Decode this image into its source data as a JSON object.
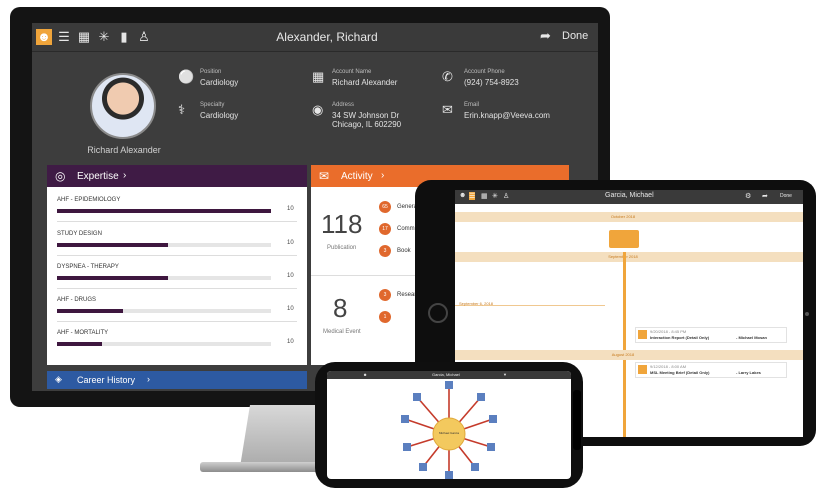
{
  "monitor": {
    "topbar": {
      "title": "Alexander, Richard",
      "done_label": "Done",
      "icons": [
        "person-icon",
        "hierarchy-icon",
        "org-chart-icon",
        "network-icon",
        "bar-chart-icon",
        "people-icon",
        "share-icon"
      ]
    },
    "profile": {
      "name": "Richard Alexander",
      "fields": [
        {
          "label": "Position",
          "value": "Cardiology"
        },
        {
          "label": "Specialty",
          "value": "Cardiology"
        },
        {
          "label": "Account Name",
          "value": "Richard Alexander"
        },
        {
          "label": "Address",
          "value": "34 SW Johnson Dr\nChicago, IL 602290"
        },
        {
          "label": "Account Phone",
          "value": "(924) 754-8923"
        },
        {
          "label": "Email",
          "value": "Erin.knapp@Veeva.com"
        }
      ]
    },
    "expertise": {
      "header": "Expertise",
      "items": [
        {
          "label": "AHF - EPIDEMIOLOGY",
          "value": 10,
          "fill": 1.0
        },
        {
          "label": "STUDY DESIGN",
          "value": 10,
          "fill": 0.52
        },
        {
          "label": "DYSPNEA - THERAPY",
          "value": 10,
          "fill": 0.52
        },
        {
          "label": "AHF - DRUGS",
          "value": 10,
          "fill": 0.31
        },
        {
          "label": "AHF - MORTALITY",
          "value": 10,
          "fill": 0.21
        }
      ]
    },
    "activity": {
      "header": "Activity",
      "stats": [
        {
          "number": "118",
          "caption": "Publication",
          "sub": [
            {
              "count": "65",
              "label": "General"
            },
            {
              "count": "17",
              "label": "Comm"
            },
            {
              "count": "3",
              "label": "Book"
            }
          ]
        },
        {
          "number": "8",
          "caption": "Medical Event",
          "sub": [
            {
              "count": "3",
              "label": "Resear"
            },
            {
              "count": "1",
              "label": ""
            }
          ]
        }
      ]
    },
    "career": {
      "header": "Career History"
    }
  },
  "tablet": {
    "title": "Garcia, Michael",
    "done_label": "Done",
    "bands": [
      "October 2018",
      "September 2018",
      "August 2018"
    ],
    "marker": "September 6, 2018",
    "cards": [
      {
        "date": "9/20/2018 - 8:45 PM",
        "title": "Interaction Report (Detail Only)",
        "who": "- Michael Mosan"
      },
      {
        "date": "9/12/2018 - 8:00 AM",
        "title": "MSL Meeting Brief (Detail Only)",
        "who": "- Larry Lakes"
      }
    ]
  },
  "phone": {
    "title": "Garcia, Michael",
    "center_label": "Michael Garcia"
  }
}
